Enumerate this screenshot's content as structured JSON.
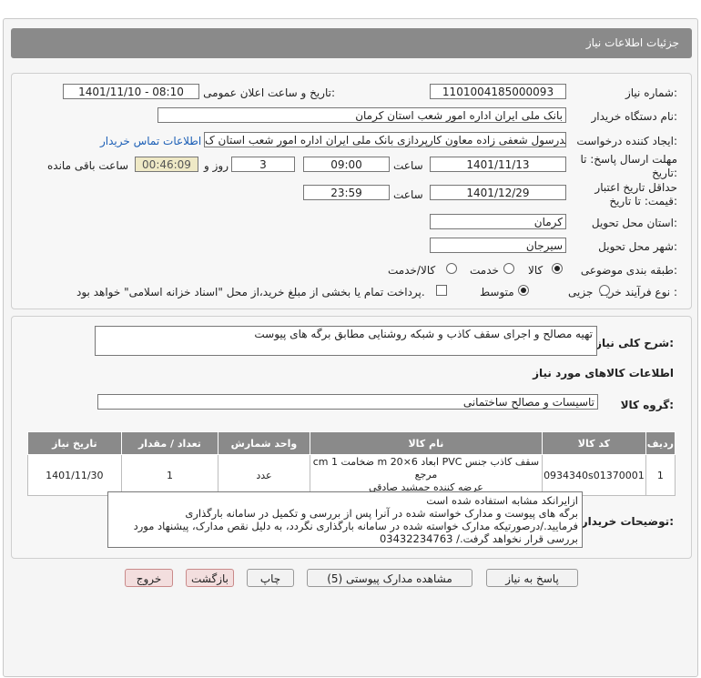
{
  "header": {
    "title": "جزئیات اطلاعات نیاز"
  },
  "form": {
    "need_number_label": "شماره نیاز:",
    "need_number": "1101004185000093",
    "announce_label": "تاریخ و ساعت اعلان عمومی:",
    "announce_value": "1401/11/10 - 08:10",
    "buyer_label": "نام دستگاه خریدار:",
    "buyer_value": "بانک ملی ایران اداره امور شعب استان کرمان",
    "creator_label": "ایجاد کننده درخواست:",
    "creator_value": "مجدرسول شعفی زاده معاون کارپردازی بانک ملی ایران اداره امور شعب استان ک",
    "contact_link": "اطلاعات تماس خریدار",
    "deadline_label_1": "مهلت ارسال پاسخ: تا",
    "deadline_label_2": "تاریخ:",
    "deadline_date": "1401/11/13",
    "time_label": "ساعت",
    "deadline_time": "09:00",
    "days_value": "3",
    "days_label": "روز و",
    "remaining_time": "00:46:09",
    "remaining_label": "ساعت باقی مانده",
    "validity_label_1": "حداقل تاریخ اعتبار",
    "validity_label_2": "قیمت: تا تاریخ:",
    "validity_date": "1401/12/29",
    "validity_time": "23:59",
    "province_label": "استان محل تحویل:",
    "province_value": "کرمان",
    "city_label": "شهر محل تحویل:",
    "city_value": "سیرجان",
    "category_label": "طبقه بندی موضوعی:",
    "category_options": [
      "کالا",
      "خدمت",
      "کالا/خدمت"
    ],
    "category_selected": "کالا",
    "process_label": "نوع فرآیند خرید :",
    "process_options": [
      "جزیی",
      "متوسط"
    ],
    "process_selected": "متوسط",
    "payment_note": "پرداخت تمام یا بخشی از مبلغ خرید،از محل \"اسناد خزانه اسلامی\" خواهد بود."
  },
  "summary": {
    "label": "شرح کلی نیاز:",
    "value": "تهیه مصالح و اجرای سقف کاذب و شبکه روشنایی  مطابق برگه های پیوست"
  },
  "goods": {
    "section_title": "اطلاعات کالاهای مورد نیاز",
    "group_label": "گروه کالا:",
    "group_value": "تاسیسات و مصالح ساختمانی",
    "columns": [
      "ردیف",
      "کد کالا",
      "نام کالا",
      "واحد شمارش",
      "تعداد / مقدار",
      "تاریخ نیاز"
    ],
    "rows": [
      {
        "row": "1",
        "code": "0934340s01370001",
        "name_line1": "سقف کاذب جنس PVC ابعاد 6×20 m ضخامت 1 cm مرجع",
        "name_line2": "عرضه کننده جمشید صادقی",
        "unit": "عدد",
        "qty": "1",
        "date": "1401/11/30"
      }
    ]
  },
  "notes": {
    "label": "توضیحات خریدار:",
    "lines": [
      "ازایرانکد مشابه استفاده شده است",
      "برگه های پیوست و مدارک خواسته شده در آنرا پس از بررسی و تکمیل در سامانه بارگذاری",
      "فرمایید./درصورتیکه مدارک خواسته شده در سامانه بارگذاری نگردد، به دلیل نقص مدارک، پیشنهاد مورد",
      "بررسی قرار نخواهد گرفت./ 03432234763"
    ]
  },
  "buttons": {
    "reply": "پاسخ به نیاز",
    "attachments": "مشاهده مدارک پیوستی (5)",
    "print": "چاپ",
    "back": "بازگشت",
    "exit": "خروج"
  }
}
